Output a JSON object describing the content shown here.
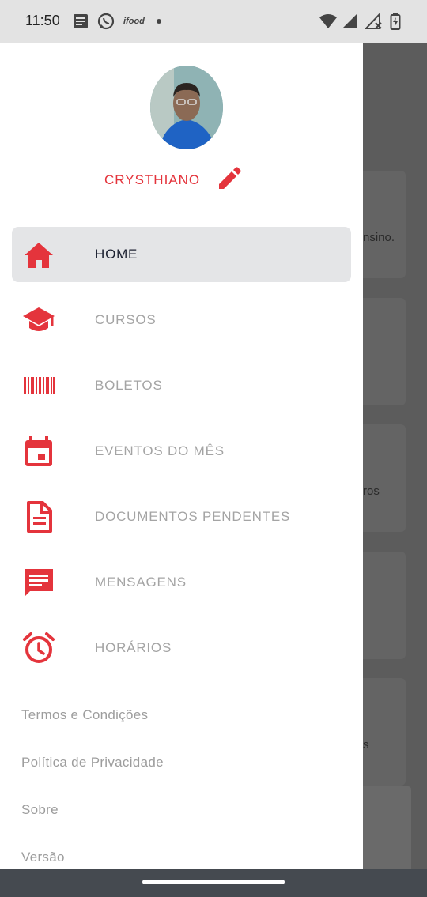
{
  "status_bar": {
    "time": "11:50",
    "left_icons": [
      "news-icon",
      "whatsapp-icon",
      "ifood-icon",
      "dot-icon"
    ],
    "right_icons": [
      "wifi-icon",
      "signal-icon",
      "signal-off-icon",
      "battery-charging-icon"
    ],
    "ifood_label": "ifood"
  },
  "drawer": {
    "user_name": "CRYSTHIANO",
    "menu": [
      {
        "label": "HOME",
        "icon": "home-icon",
        "active": true
      },
      {
        "label": "CURSOS",
        "icon": "graduation-cap-icon",
        "active": false
      },
      {
        "label": "BOLETOS",
        "icon": "barcode-icon",
        "active": false
      },
      {
        "label": "EVENTOS DO MÊS",
        "icon": "calendar-icon",
        "active": false
      },
      {
        "label": "DOCUMENTOS PENDENTES",
        "icon": "document-icon",
        "active": false
      },
      {
        "label": "MENSAGENS",
        "icon": "message-icon",
        "active": false
      },
      {
        "label": "HORÁRIOS",
        "icon": "alarm-clock-icon",
        "active": false
      }
    ],
    "footer_links": [
      "Termos e Condições",
      "Política de Privacidade",
      "Sobre",
      "Versão"
    ]
  },
  "background_page": {
    "card_texts": [
      "nsino.",
      "ros",
      "s"
    ]
  },
  "colors": {
    "accent": "#e4343c",
    "active_bg": "#e4e5e7",
    "inactive_text": "#a4a4a4",
    "active_text": "#1b2030"
  }
}
